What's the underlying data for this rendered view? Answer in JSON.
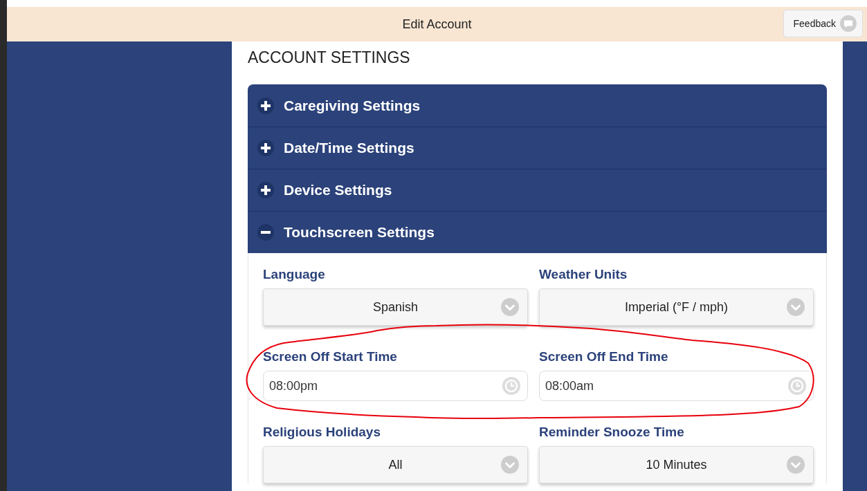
{
  "header": {
    "title": "Edit Account",
    "feedback_button": "Feedback"
  },
  "page_title": "ACCOUNT SETTINGS",
  "sections": [
    {
      "title": "Caregiving Settings",
      "expanded": false
    },
    {
      "title": "Date/Time Settings",
      "expanded": false
    },
    {
      "title": "Device Settings",
      "expanded": false
    },
    {
      "title": "Touchscreen Settings",
      "expanded": true,
      "fields": [
        {
          "kind": "select",
          "label": "Language",
          "value": "Spanish"
        },
        {
          "kind": "select",
          "label": "Weather Units",
          "value": "Imperial (°F / mph)"
        },
        {
          "kind": "time",
          "label": "Screen Off Start Time",
          "value": "08:00pm"
        },
        {
          "kind": "time",
          "label": "Screen Off End Time",
          "value": "08:00am"
        },
        {
          "kind": "select",
          "label": "Religious Holidays",
          "value": "All"
        },
        {
          "kind": "select",
          "label": "Reminder Snooze Time",
          "value": "10 Minutes"
        }
      ]
    }
  ]
}
